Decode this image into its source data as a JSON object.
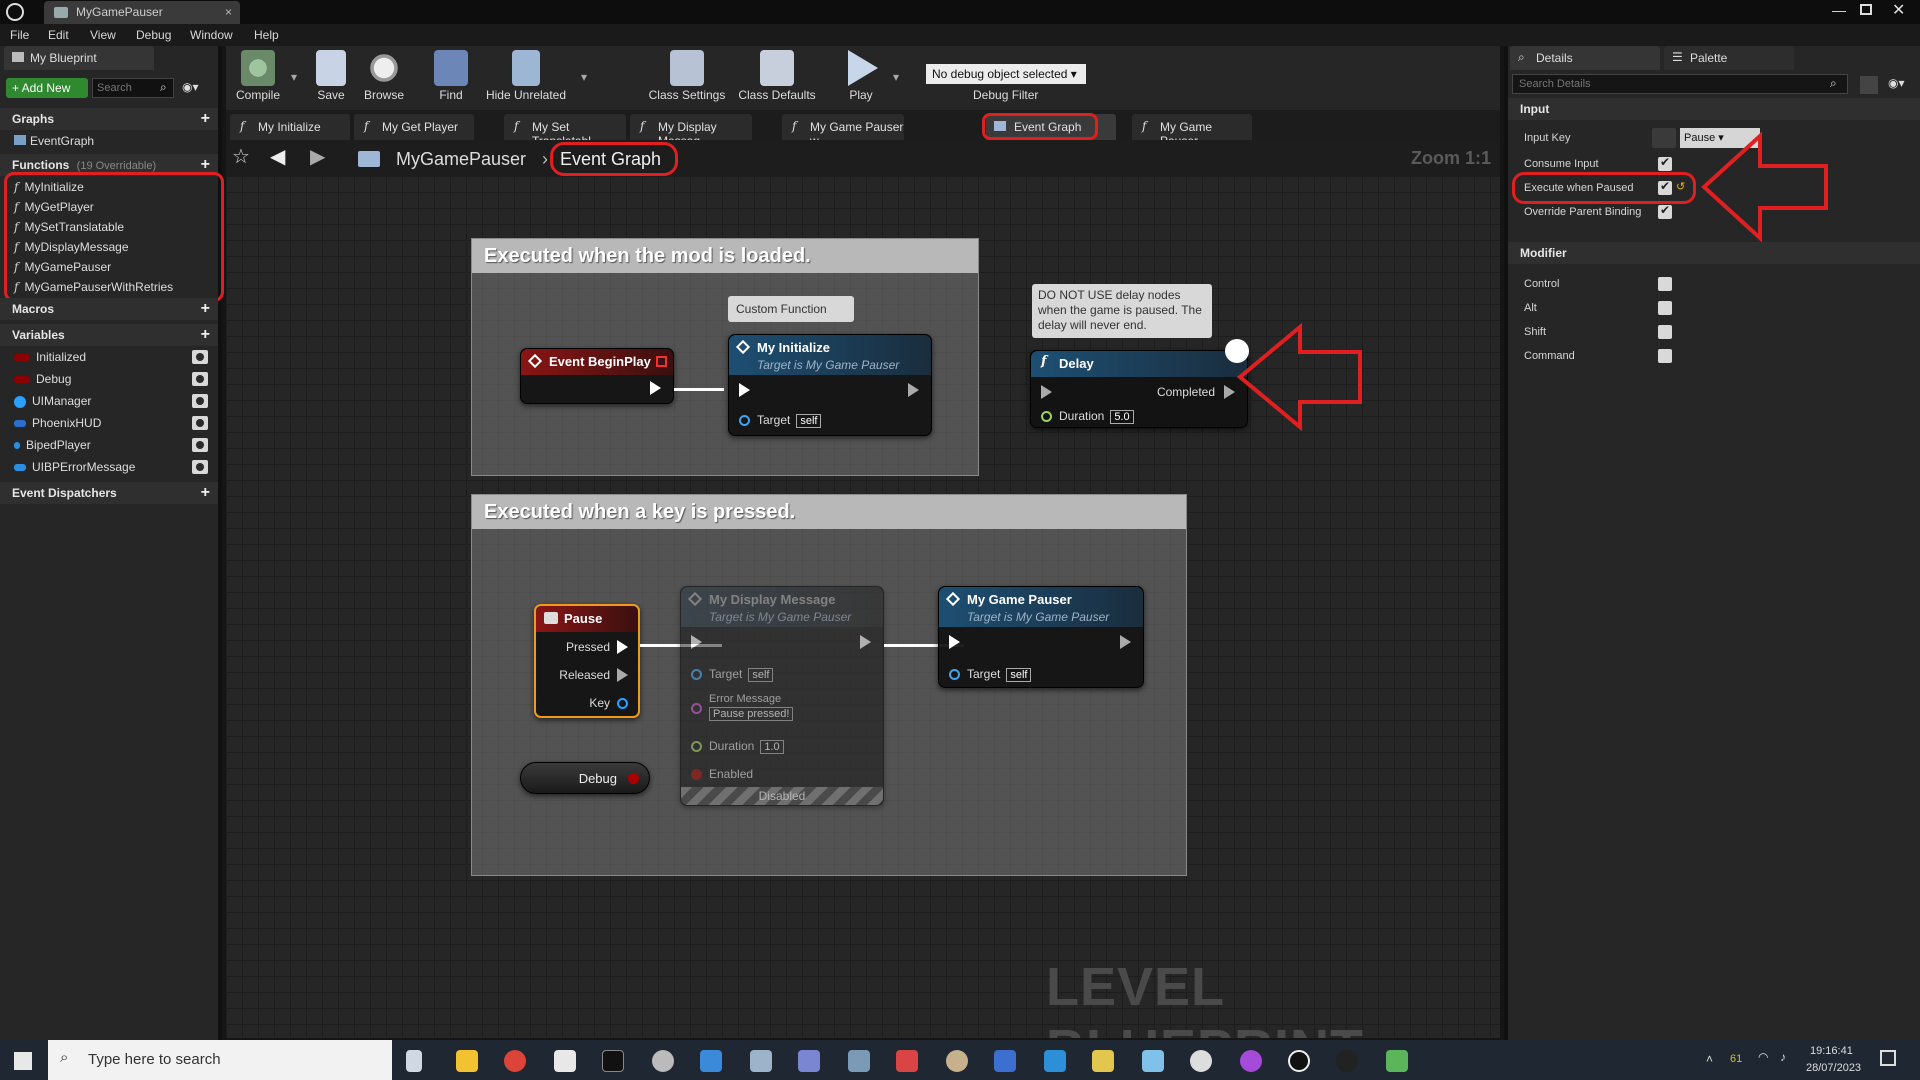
{
  "window": {
    "doc_tab": "MyGamePauser"
  },
  "menu": [
    "File",
    "Edit",
    "View",
    "Debug",
    "Window",
    "Help"
  ],
  "left": {
    "tab": "My Blueprint",
    "add_new": "+ Add New",
    "search_placeholder": "Search",
    "graphs": {
      "title": "Graphs",
      "items": [
        "EventGraph"
      ]
    },
    "functions": {
      "title": "Functions",
      "count": "(19 Overridable)",
      "items": [
        "MyInitialize",
        "MyGetPlayer",
        "MySetTranslatable",
        "MyDisplayMessage",
        "MyGamePauser",
        "MyGamePauserWithRetries"
      ]
    },
    "macros": {
      "title": "Macros"
    },
    "variables": {
      "title": "Variables",
      "items": [
        {
          "name": "Initialized",
          "color": "#8b0000"
        },
        {
          "name": "Debug",
          "color": "#8b0000"
        },
        {
          "name": "UIManager",
          "color": "#2aa0ff"
        },
        {
          "name": "PhoenixHUD",
          "color": "#2a6fd0"
        },
        {
          "name": "BipedPlayer",
          "color": "#2a8fe0"
        },
        {
          "name": "UIBPErrorMessage",
          "color": "#2a8fe0"
        }
      ]
    },
    "dispatchers": {
      "title": "Event Dispatchers"
    }
  },
  "toolbar": {
    "compile": "Compile",
    "save": "Save",
    "browse": "Browse",
    "find": "Find",
    "hide_unrelated": "Hide Unrelated",
    "class_settings": "Class Settings",
    "class_defaults": "Class Defaults",
    "play": "Play",
    "debug_select": "No debug object selected",
    "debug_filter": "Debug Filter"
  },
  "graph_tabs": [
    "My Initialize",
    "My Get Player",
    "My Set Translatabl",
    "My Display Messag",
    "My Game Pauser w",
    "Event Graph",
    "My Game Pauser"
  ],
  "breadcrumb": {
    "root": "MyGamePauser",
    "current": "Event Graph",
    "zoom": "Zoom 1:1"
  },
  "graph": {
    "comment1": "Executed when the mod is loaded.",
    "comment2": "Executed when a key is pressed.",
    "event_beginplay": "Event BeginPlay",
    "custom_function_tag": "Custom Function",
    "my_initialize": {
      "title": "My Initialize",
      "sub": "Target is My Game Pauser",
      "target": "Target",
      "self": "self"
    },
    "note": "DO NOT USE delay nodes when the game is paused. The delay will never end.",
    "delay": {
      "title": "Delay",
      "completed": "Completed",
      "duration_label": "Duration",
      "duration": "5.0"
    },
    "pause": {
      "title": "Pause",
      "pressed": "Pressed",
      "released": "Released",
      "key": "Key"
    },
    "display_msg": {
      "title": "My Display Message",
      "sub": "Target is My Game Pauser",
      "target": "Target",
      "self": "self",
      "error_label": "Error Message",
      "error_value": "Pause pressed!",
      "duration_label": "Duration",
      "duration": "1.0",
      "enabled": "Enabled",
      "disabled": "Disabled"
    },
    "game_pauser": {
      "title": "My Game Pauser",
      "sub": "Target is My Game Pauser",
      "target": "Target",
      "self": "self"
    },
    "debug_var": "Debug",
    "watermark": "LEVEL BLUEPRINT"
  },
  "details": {
    "tab": "Details",
    "palette_tab": "Palette",
    "search_placeholder": "Search Details",
    "input_section": "Input",
    "input_key_label": "Input Key",
    "input_key_value": "Pause",
    "consume_input": {
      "label": "Consume Input",
      "checked": true
    },
    "execute_when_paused": {
      "label": "Execute when Paused",
      "checked": true
    },
    "override_parent": {
      "label": "Override Parent Binding",
      "checked": true
    },
    "modifier_section": "Modifier",
    "modifiers": [
      {
        "label": "Control",
        "checked": false
      },
      {
        "label": "Alt",
        "checked": false
      },
      {
        "label": "Shift",
        "checked": false
      },
      {
        "label": "Command",
        "checked": false
      }
    ]
  },
  "taskbar": {
    "search_placeholder": "Type here to search",
    "time": "19:16:41",
    "date": "28/07/2023",
    "temp": "61"
  },
  "colors": {
    "accent_red": "#e02020",
    "event_header": "#8a1515",
    "function_header": "#1d4f73",
    "selection": "#f29a18"
  }
}
